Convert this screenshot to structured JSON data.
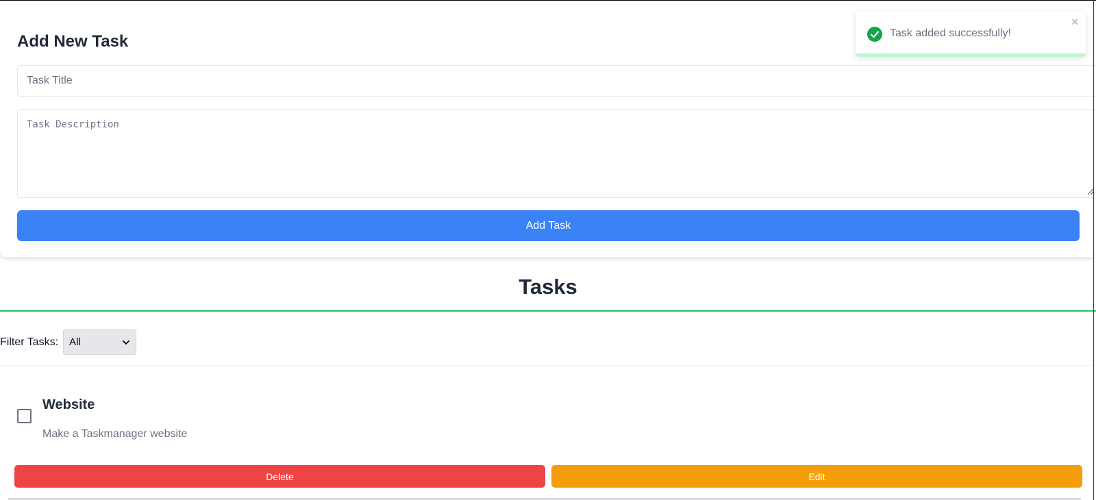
{
  "form": {
    "title": "Add New Task",
    "title_placeholder": "Task Title",
    "title_value": "",
    "description_placeholder": "Task Description",
    "description_value": "",
    "add_button_label": "Add Task"
  },
  "toast": {
    "message": "Task added successfully!",
    "close_glyph": "×",
    "icon": "check-circle-icon",
    "progress_remaining": 1.0
  },
  "tasks_section": {
    "heading": "Tasks",
    "filter_label": "Filter Tasks:",
    "filter_selected": "All"
  },
  "tasks": [
    {
      "title": "Website",
      "description": "Make a Taskmanager website",
      "completed": false,
      "delete_label": "Delete",
      "edit_label": "Edit"
    }
  ],
  "colors": {
    "primary": "#3b82f6",
    "danger": "#ef4444",
    "warning": "#f59e0b",
    "success": "#22c55e"
  }
}
